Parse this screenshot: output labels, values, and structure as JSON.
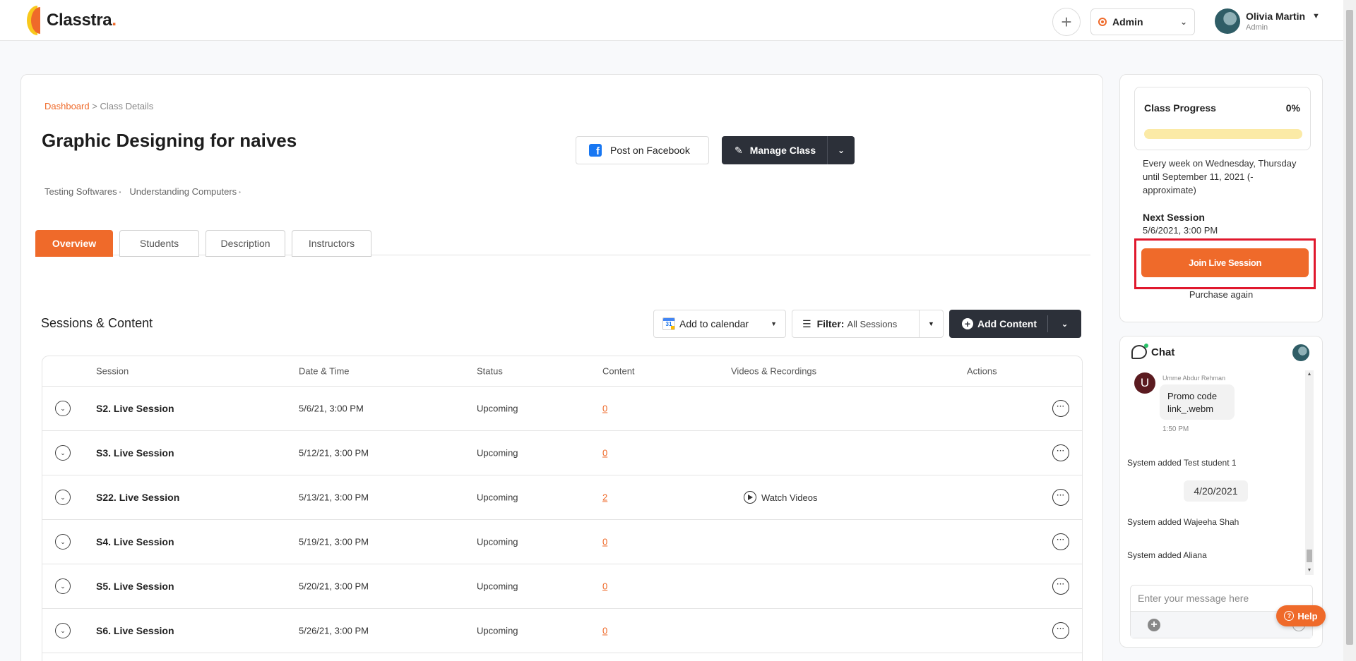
{
  "header": {
    "logo_text": "Classtra",
    "logo_dot": ".",
    "role": "Admin",
    "user_name": "Olivia Martin",
    "user_role": "Admin"
  },
  "breadcrumb": {
    "root": "Dashboard",
    "separator": ">",
    "current": "Class Details"
  },
  "class": {
    "title": "Graphic Designing for naives",
    "tags": [
      "Testing Softwares",
      "Understanding Computers"
    ],
    "post_facebook_label": "Post on Facebook",
    "manage_label": "Manage Class"
  },
  "tabs": [
    "Overview",
    "Students",
    "Description",
    "Instructors"
  ],
  "active_tab": "Overview",
  "sessions": {
    "title": "Sessions & Content",
    "add_calendar_label": "Add to calendar",
    "filter_label": "Filter:",
    "filter_value": "All Sessions",
    "add_content_label": "Add Content",
    "columns": [
      "Session",
      "Date & Time",
      "Status",
      "Content",
      "Videos & Recordings",
      "Actions"
    ],
    "rows": [
      {
        "session": "S2. Live Session",
        "datetime": "5/6/21, 3:00 PM",
        "status": "Upcoming",
        "content": "0",
        "videos": ""
      },
      {
        "session": "S3. Live Session",
        "datetime": "5/12/21, 3:00 PM",
        "status": "Upcoming",
        "content": "0",
        "videos": ""
      },
      {
        "session": "S22. Live Session",
        "datetime": "5/13/21, 3:00 PM",
        "status": "Upcoming",
        "content": "2",
        "videos": "Watch Videos"
      },
      {
        "session": "S4. Live Session",
        "datetime": "5/19/21, 3:00 PM",
        "status": "Upcoming",
        "content": "0",
        "videos": ""
      },
      {
        "session": "S5. Live Session",
        "datetime": "5/20/21, 3:00 PM",
        "status": "Upcoming",
        "content": "0",
        "videos": ""
      },
      {
        "session": "S6. Live Session",
        "datetime": "5/26/21, 3:00 PM",
        "status": "Upcoming",
        "content": "0",
        "videos": ""
      }
    ]
  },
  "progress": {
    "title": "Class Progress",
    "percent_label": "0%",
    "percent": 0,
    "schedule": "Every week on Wednesday, Thursday until September 11, 2021 (-approximate)",
    "next_session_title": "Next Session",
    "next_session_date": "5/6/2021, 3:00 PM",
    "join_label": "Join Live Session",
    "purchase_label": "Purchase again"
  },
  "chat": {
    "title": "Chat",
    "messages": {
      "avatar_letter": "U",
      "sender": "Umme Abdur Rehman",
      "text": "Promo code link_.webm",
      "time": "1:50 PM"
    },
    "system_1": "System added Test student 1",
    "date_divider": "4/20/2021",
    "system_2": "System added Wajeeha Shah",
    "system_3": "System added Aliana",
    "input_placeholder": "Enter your message here"
  },
  "help_label": "Help",
  "colors": {
    "accent": "#ef6a2a",
    "dark_button": "#2c3039",
    "highlight_frame": "#e0182d",
    "progress_track": "#fbeaa6"
  }
}
